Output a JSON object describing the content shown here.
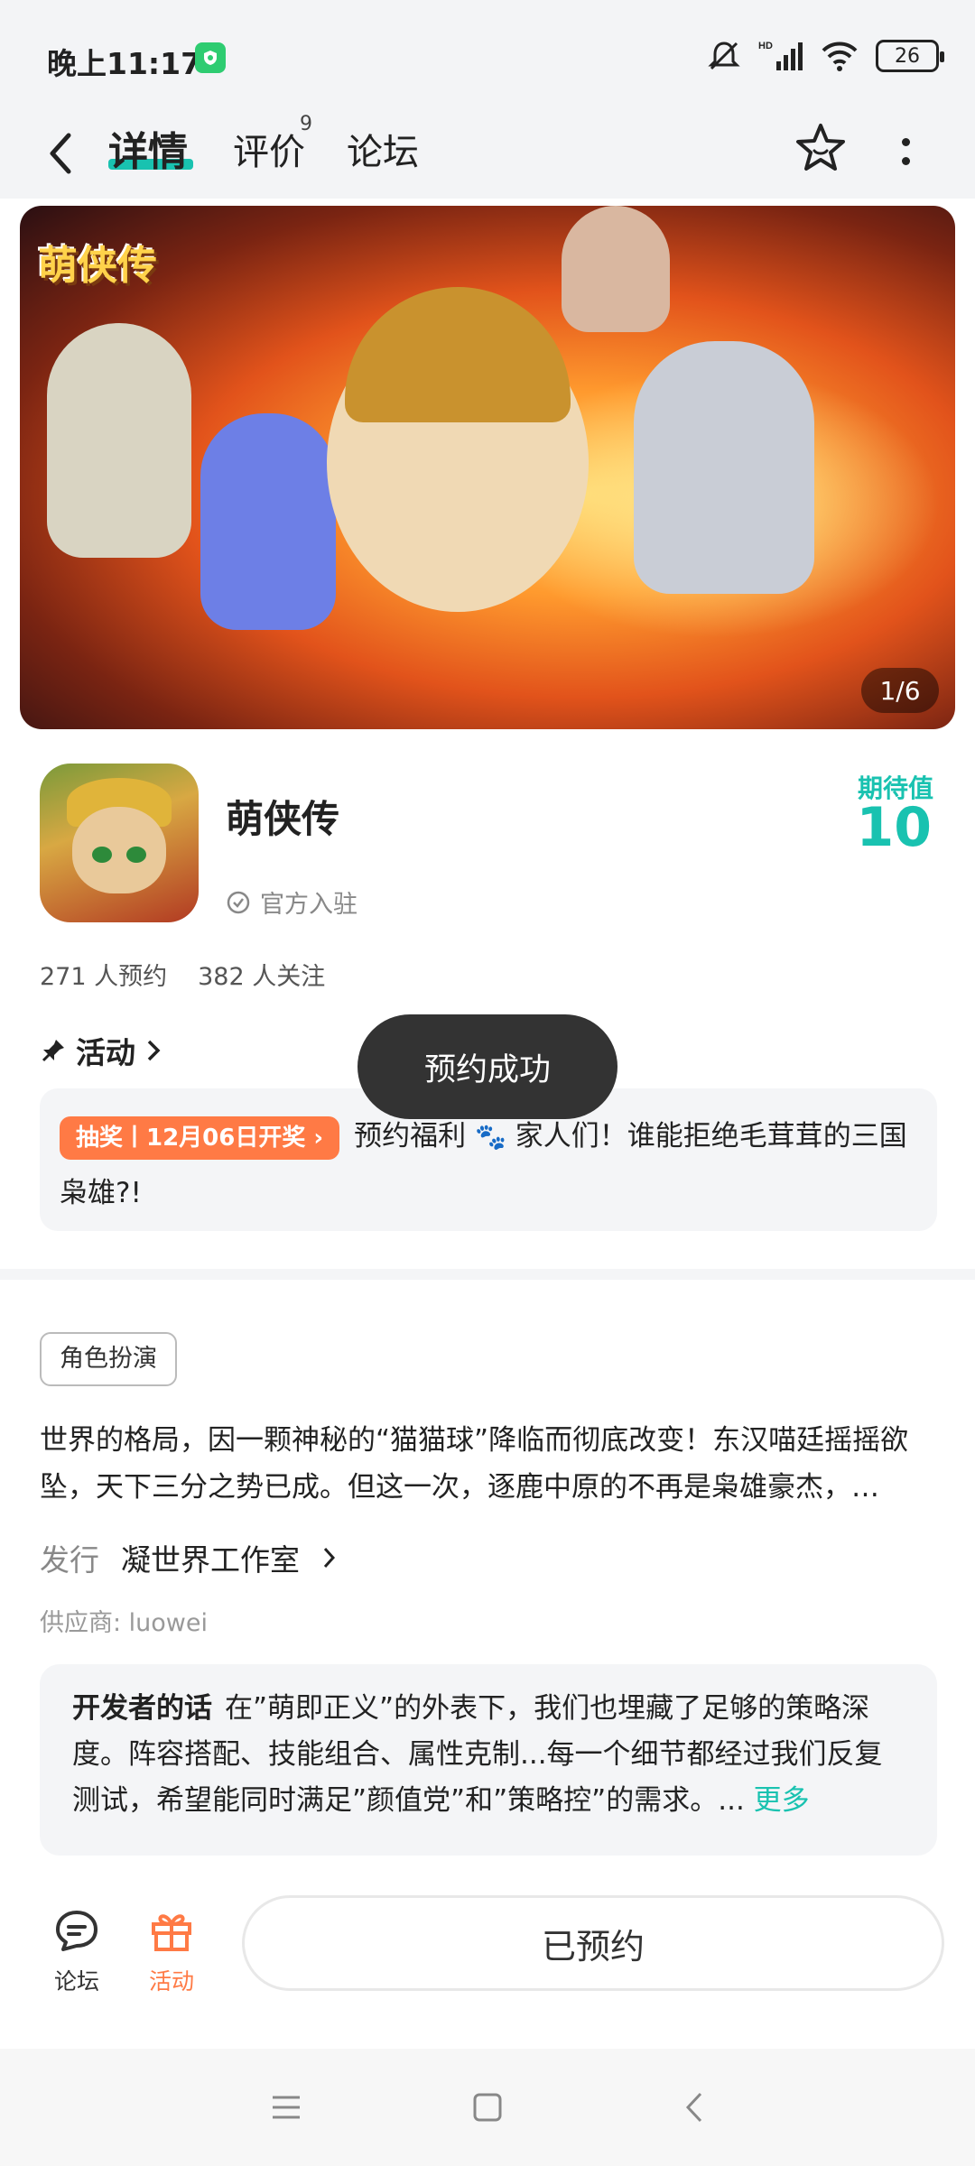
{
  "status": {
    "time": "晚上11:17",
    "battery": "26"
  },
  "nav": {
    "tabs": [
      {
        "label": "详情",
        "active": true
      },
      {
        "label": "评价",
        "badge": "9"
      },
      {
        "label": "论坛"
      }
    ]
  },
  "banner": {
    "logo_text": "萌侠传",
    "counter": "1/6"
  },
  "app": {
    "title": "萌侠传",
    "official_label": "官方入驻",
    "expect_label": "期待值",
    "expect_value": "10",
    "reservations": "271 人预约",
    "followers": "382 人关注"
  },
  "activity": {
    "heading": "活动",
    "tag": "抽奖丨12月06日开奖",
    "text_before": "预约福利",
    "text_after": "家人们！谁能拒绝毛茸茸的三国枭雄?!"
  },
  "toast": "预约成功",
  "genre_tag": "角色扮演",
  "description": "世界的格局，因一颗神秘的“猫猫球”降临而彻底改变！东汉喵廷摇摇欲坠，天下三分之势已成。但这一次，逐鹿中原的不再是枭雄豪杰，…",
  "publisher": {
    "label": "发行",
    "name": "凝世界工作室"
  },
  "supplier": "供应商: luowei",
  "developer_note": {
    "title": "开发者的话",
    "text": "在”萌即正义”的外表下，我们也埋藏了足够的策略深度。阵容搭配、技能组合、属性克制...每一个细节都经过我们反复测试，希望能同时满足”颜值党”和”策略控”的需求。...",
    "more": "更多"
  },
  "bottom_bar": {
    "forum_label": "论坛",
    "activity_label": "活动",
    "reserve_button": "已预约"
  },
  "colors": {
    "accent": "#19c2b0",
    "orange": "#ff7a45",
    "toast_bg": "#333333"
  }
}
